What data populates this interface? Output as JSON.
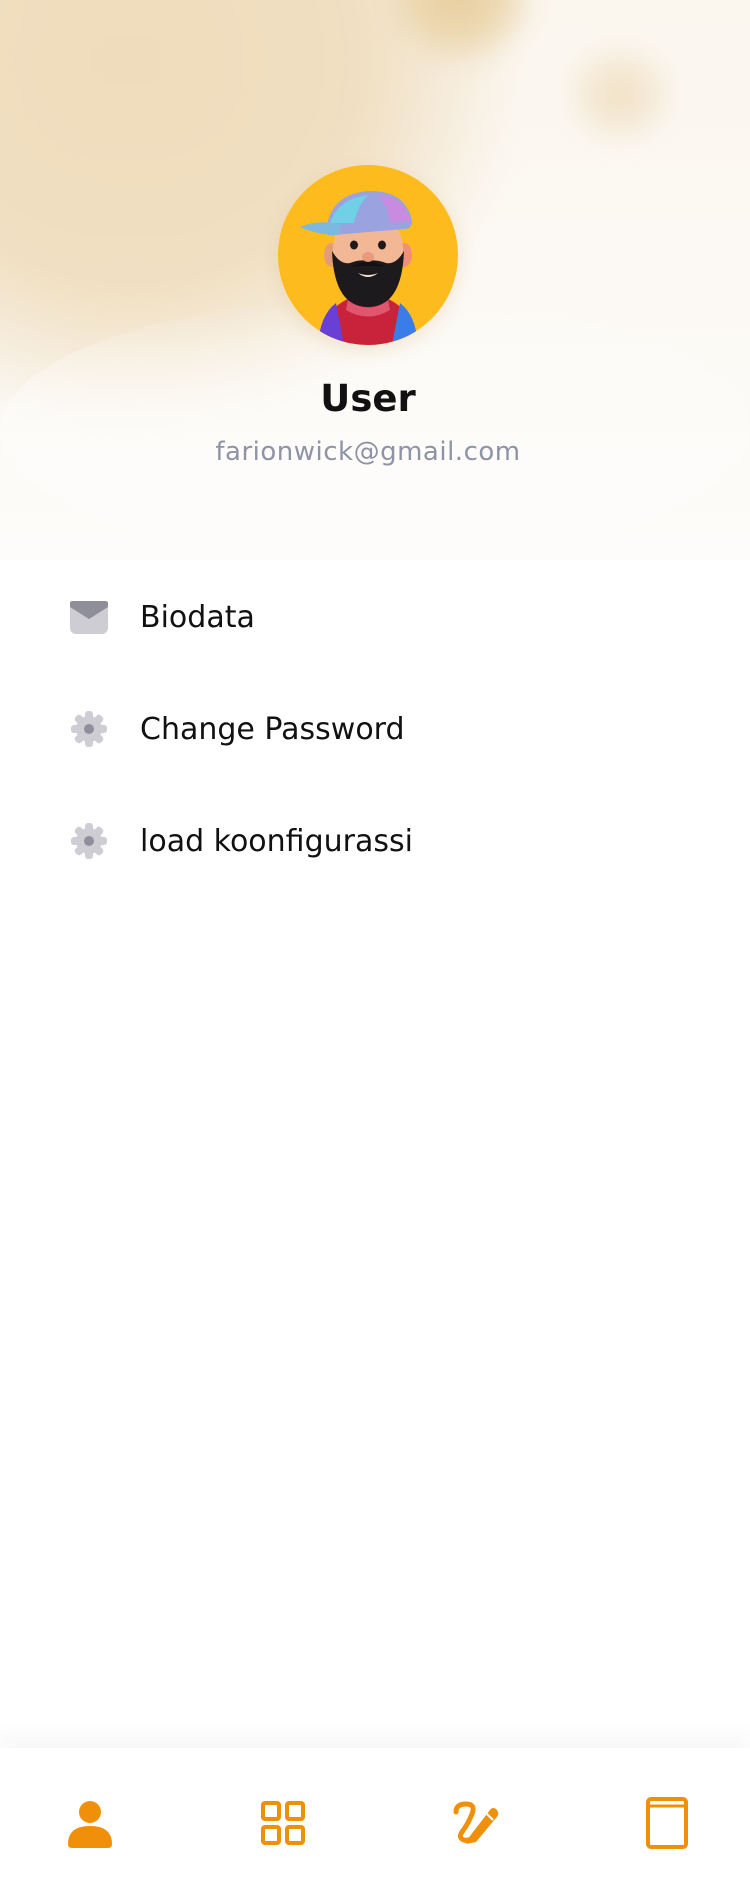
{
  "profile": {
    "name": "User",
    "email": "farionwick@gmail.com",
    "avatar_icon": "bearded-man-avatar"
  },
  "menu": {
    "items": [
      {
        "label": "Biodata",
        "icon": "envelope-icon"
      },
      {
        "label": "Change Password",
        "icon": "gear-icon"
      },
      {
        "label": "load koonfigurassi",
        "icon": "gear-icon"
      }
    ]
  },
  "bottom_nav": {
    "items": [
      {
        "icon": "person-icon",
        "active": true
      },
      {
        "icon": "grid-icon",
        "active": false
      },
      {
        "icon": "edit-icon",
        "active": false
      },
      {
        "icon": "book-icon",
        "active": false
      }
    ]
  },
  "colors": {
    "accent": "#f0900a",
    "avatar_bg": "#fdbb1e",
    "menu_icon": "#cdcdd3",
    "email_text": "#8e93a6"
  }
}
